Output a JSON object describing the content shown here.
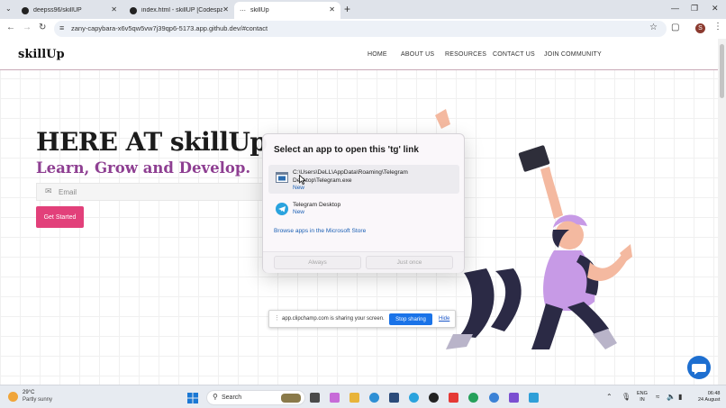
{
  "browser": {
    "tabs": [
      {
        "title": "deepss96/skillUP",
        "icon": "github-icon"
      },
      {
        "title": "index.html - skillUP [Codespaces]",
        "icon": "github-icon"
      },
      {
        "title": "skillUp",
        "icon": "link-icon"
      }
    ],
    "url": "zany-capybara-x6v5qw5vw7j39qp6-5173.app.github.dev/#contact",
    "profile_initial": "S"
  },
  "site": {
    "logo": "skillUp",
    "nav": [
      "HOME",
      "ABOUT US",
      "RESOURCES",
      "CONTACT US",
      "JOIN COMMUNITY"
    ],
    "hero_title": "HERE AT skillUp",
    "hero_subtitle": "Learn, Grow and Develop.",
    "email_placeholder": "Email",
    "cta_label": "Get Started",
    "accent_color": "#e2407a",
    "subtitle_color": "#8e3f92"
  },
  "dialog": {
    "title": "Select an app to open this 'tg' link",
    "options": [
      {
        "name": "C:\\Users\\DeLL\\AppData\\Roaming\\Telegram Desktop\\Telegram.exe",
        "badge": "New",
        "icon": "app-window-icon",
        "selected": true
      },
      {
        "name": "Telegram Desktop",
        "badge": "New",
        "icon": "telegram-icon",
        "selected": false
      }
    ],
    "store_link": "Browse apps in the Microsoft Store",
    "always_label": "Always",
    "once_label": "Just once"
  },
  "share_bar": {
    "message": "app.clipchamp.com is sharing your screen.",
    "stop_label": "Stop sharing",
    "hide_label": "Hide"
  },
  "taskbar": {
    "temperature": "29°C",
    "weather": "Partly sunny",
    "search_label": "Search",
    "language_line1": "ENG",
    "language_line2": "IN",
    "time": "06:48",
    "date": "24 August"
  }
}
